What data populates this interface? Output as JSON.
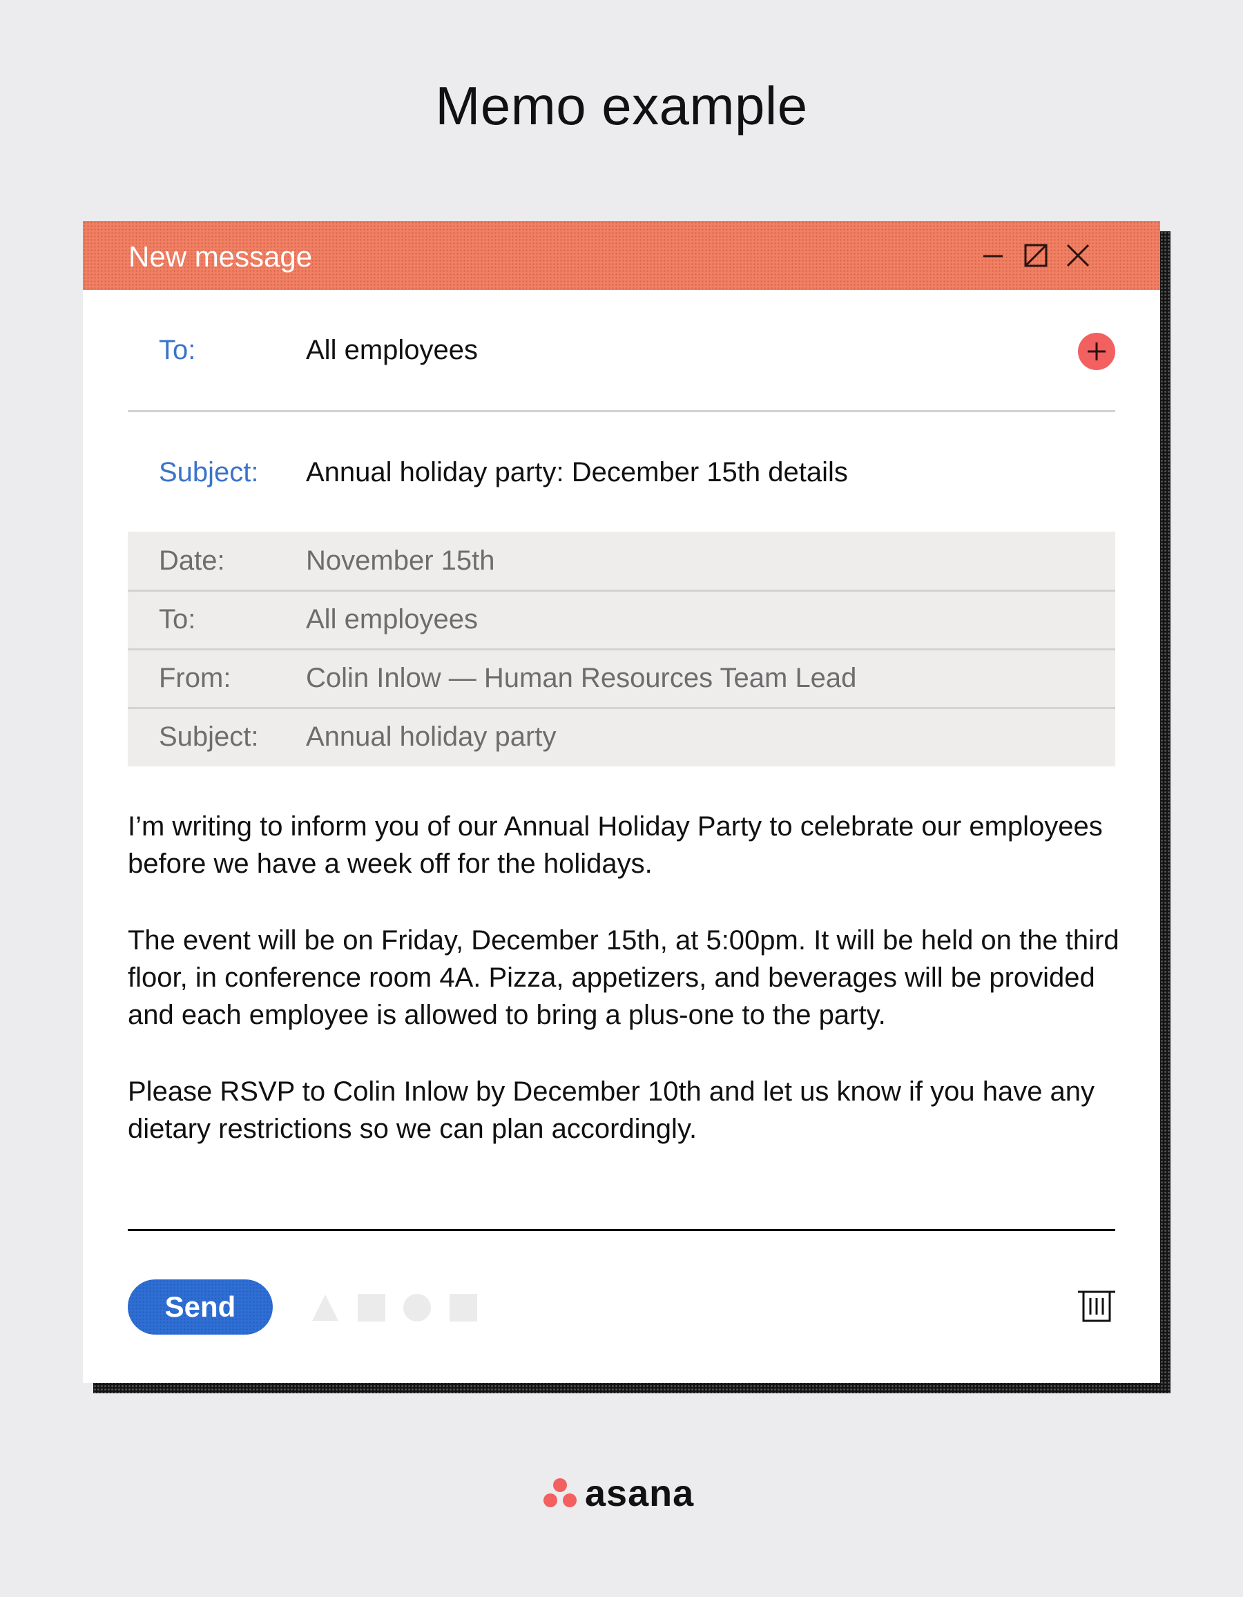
{
  "page": {
    "title": "Memo example"
  },
  "window": {
    "title": "New message",
    "controls": [
      {
        "name": "minimize",
        "icon": "minimize-icon"
      },
      {
        "name": "maximize",
        "icon": "maximize-icon"
      },
      {
        "name": "close",
        "icon": "close-icon"
      }
    ],
    "header_color": "#f07f63"
  },
  "compose": {
    "to_label": "To:",
    "to_value": "All employees",
    "add_recipient_icon": "plus-circle-icon",
    "subject_label": "Subject:",
    "subject_value": "Annual holiday party: December 15th details",
    "label_color": "#3a74c9"
  },
  "memo_header": {
    "rows": [
      {
        "label": "Date:",
        "value": "November 15th"
      },
      {
        "label": "To:",
        "value": "All employees"
      },
      {
        "label": "From:",
        "value": "Colin Inlow — Human Resources Team Lead"
      },
      {
        "label": "Subject:",
        "value": "Annual holiday party"
      }
    ]
  },
  "body": {
    "paragraphs": [
      "I’m writing to inform you of our Annual Holiday Party to celebrate our employees before we have a week off for the holidays.",
      "The event will be on Friday, December 15th, at 5:00pm. It will be held on the third floor, in conference room 4A. Pizza, appetizers, and beverages will be provided and each employee is allowed to bring a plus-one to the party.",
      "Please RSVP to Colin Inlow by December 10th and let us know if you have any dietary restrictions so we can plan accordingly."
    ]
  },
  "footer": {
    "send_label": "Send",
    "send_color": "#2f6fd3",
    "format_icons": [
      "triangle-icon",
      "square-icon",
      "circle-icon",
      "square-icon"
    ],
    "delete_icon": "trash-icon"
  },
  "brand": {
    "name": "asana",
    "mark_color": "#f2605f"
  }
}
